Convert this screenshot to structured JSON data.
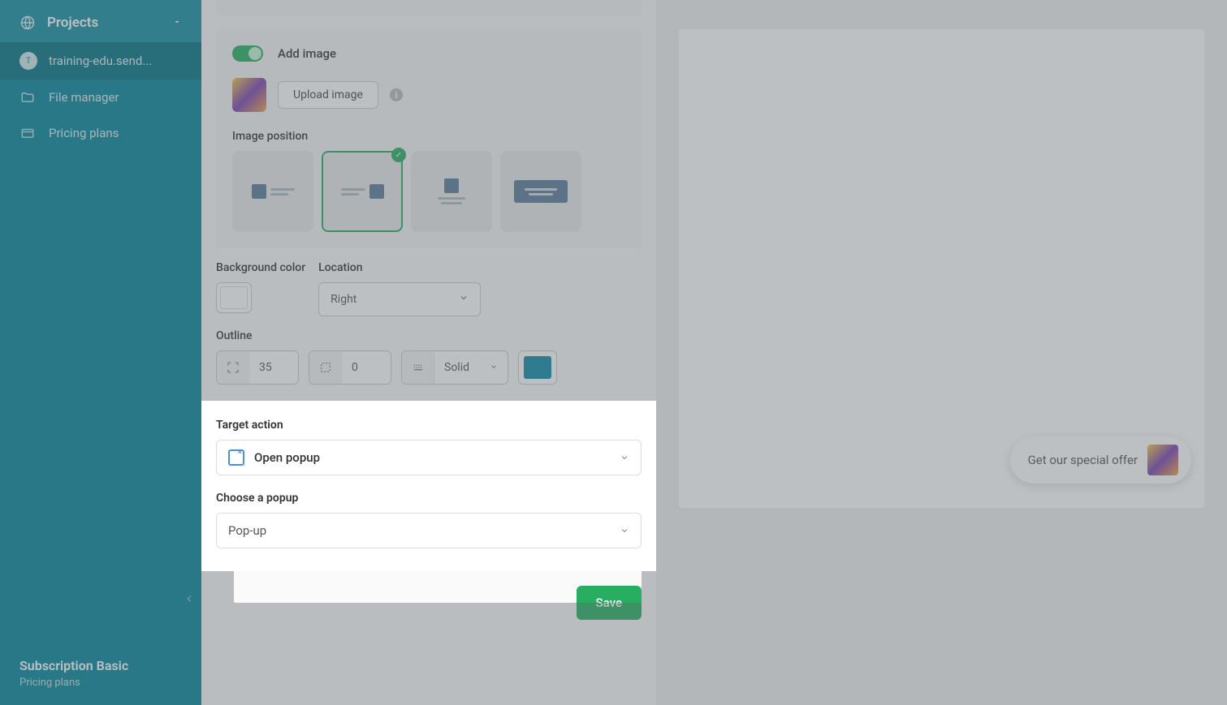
{
  "sidebar": {
    "projects_label": "Projects",
    "account_label": "training-edu.send...",
    "account_initial": "T",
    "file_manager_label": "File manager",
    "pricing_label": "Pricing plans",
    "plan_name": "Subscription Basic",
    "plan_link": "Pricing plans"
  },
  "editor": {
    "add_image_label": "Add image",
    "upload_label": "Upload image",
    "position_label": "Image position",
    "bg_label": "Background color",
    "location_label": "Location",
    "location_value": "Right",
    "outline_label": "Outline",
    "outline_radius": "35",
    "outline_width": "0",
    "outline_style": "Solid",
    "outline_color": "#1089a8",
    "target_action_label": "Target action",
    "target_action_value": "Open popup",
    "choose_popup_label": "Choose a popup",
    "choose_popup_value": "Pop-up",
    "save_label": "Save"
  },
  "preview": {
    "float_text": "Get our special offer"
  }
}
